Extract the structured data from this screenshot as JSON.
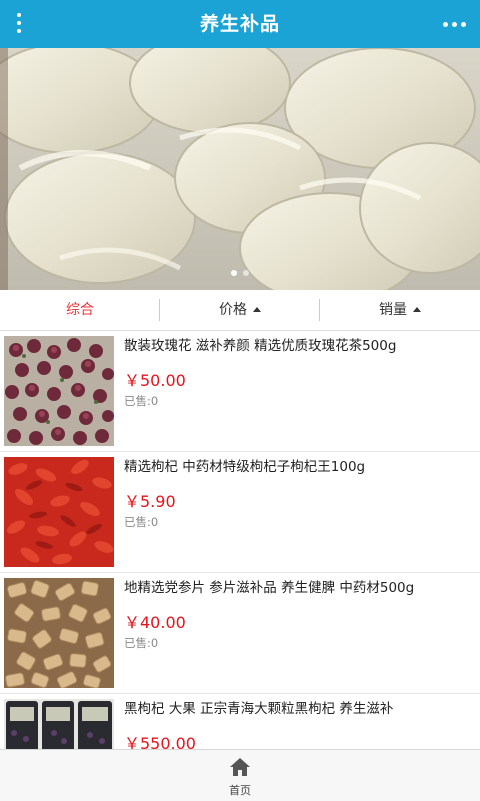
{
  "header": {
    "title": "养生补品",
    "menu_icon": "vertical-dots-icon",
    "more_icon": "horizontal-dots-icon"
  },
  "banner": {
    "image_subject": "edible bird's nest",
    "slide_count": 2,
    "active_slide": 1
  },
  "sort_tabs": [
    {
      "label": "综合",
      "active": true,
      "arrow": false
    },
    {
      "label": "价格",
      "active": false,
      "arrow": true
    },
    {
      "label": "销量",
      "active": false,
      "arrow": true
    }
  ],
  "products": [
    {
      "name": "散装玫瑰花 滋补养颜 精选优质玫瑰花茶500g",
      "price": "￥50.00",
      "sold": "已售:0",
      "image": "rose-tea"
    },
    {
      "name": "精选枸杞 中药材特级枸杞子枸杞王100g",
      "price": "￥5.90",
      "sold": "已售:0",
      "image": "goji-berry"
    },
    {
      "name": "地精选党参片 参片滋补品 养生健脾 中药材500g",
      "price": "￥40.00",
      "sold": "已售:0",
      "image": "codonopsis-slices"
    },
    {
      "name": "黑枸杞 大果 正宗青海大颗粒黑枸杞 养生滋补",
      "price": "￥550.00",
      "sold": "",
      "image": "black-goji-jars"
    }
  ],
  "tabbar": {
    "home_label": "首页",
    "home_icon": "home-icon"
  },
  "colors": {
    "accent": "#1ba3d6",
    "price": "#e4141b",
    "active_sort": "#e4393c"
  }
}
